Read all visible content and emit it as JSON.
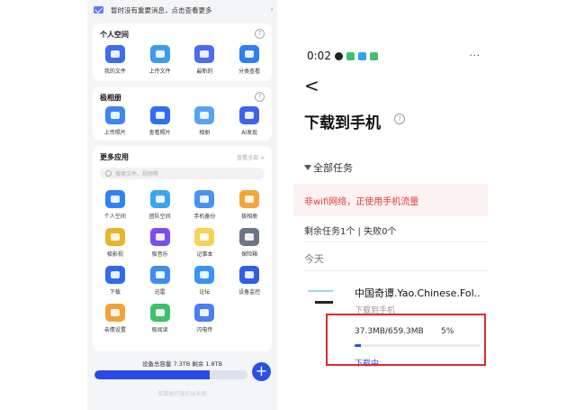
{
  "left_panel": {
    "notice_text": "暂时没有重要消息，点击查看更多",
    "personal": {
      "title": "个人空间",
      "items": [
        {
          "label": "我的文件",
          "color": "#3d6cf0"
        },
        {
          "label": "上传文件",
          "color": "#3d9bf0"
        },
        {
          "label": "最新的",
          "color": "#4a6df2"
        },
        {
          "label": "分类查看",
          "color": "#2f7ff3"
        }
      ]
    },
    "album": {
      "title": "极相册",
      "items": [
        {
          "label": "上传照片",
          "color": "#3d86f5"
        },
        {
          "label": "查看照片",
          "color": "#2f6ef2"
        },
        {
          "label": "相册",
          "color": "#57a4f7"
        },
        {
          "label": "AI发现",
          "color": "#3b63f0"
        }
      ]
    },
    "apps": {
      "title": "更多应用",
      "more_link": "查看全部 >",
      "search_placeholder": "搜索文件、视频等",
      "items": [
        {
          "label": "个人空间",
          "color": "#2f83f5"
        },
        {
          "label": "团队空间",
          "color": "#3aa5f0"
        },
        {
          "label": "手机备份",
          "color": "#4a90f7"
        },
        {
          "label": "极相册",
          "color": "#f3a63a"
        },
        {
          "label": "极影视",
          "color": "#e9b52a"
        },
        {
          "label": "极音乐",
          "color": "#7a4df0"
        },
        {
          "label": "记事本",
          "color": "#f6d25b"
        },
        {
          "label": "保险箱",
          "color": "#6a7686"
        },
        {
          "label": "下载",
          "color": "#2f6bf2"
        },
        {
          "label": "迅雷",
          "color": "#3d8bf5"
        },
        {
          "label": "论坛",
          "color": "#3b93f7"
        },
        {
          "label": "设备监控",
          "color": "#2e5fe8"
        },
        {
          "label": "亲情设置",
          "color": "#f2a23a"
        },
        {
          "label": "极阅读",
          "color": "#3ec16b"
        },
        {
          "label": "闪电传",
          "color": "#4a7cf5"
        }
      ]
    },
    "storage_text": "设备总容量 7.3TB   剩余 1.8TB",
    "storage_used_fraction": 0.75,
    "fab_label": "+",
    "footer_faded": "和数据在现在出来呢"
  },
  "right_panel": {
    "time": "0:02",
    "more_dots": "···",
    "back_icon": "<",
    "page_title": "下载到手机",
    "filter_label": "全部任务",
    "warning": "非wifi网络，正使用手机流量",
    "remaining": "剩余任务1个 | 失败0个",
    "section_today": "今天",
    "file": {
      "name": "中国奇谭.Yao.Chinese.Fol..",
      "destination": "下载到手机",
      "progress_text": "37.3MB/659.3MB",
      "percent_text": "5%",
      "percent": 5,
      "status": "下载中"
    }
  },
  "colors": {
    "accent": "#2a52e8",
    "warning_text": "#e53a3a",
    "highlight_box": "#e0292e"
  }
}
